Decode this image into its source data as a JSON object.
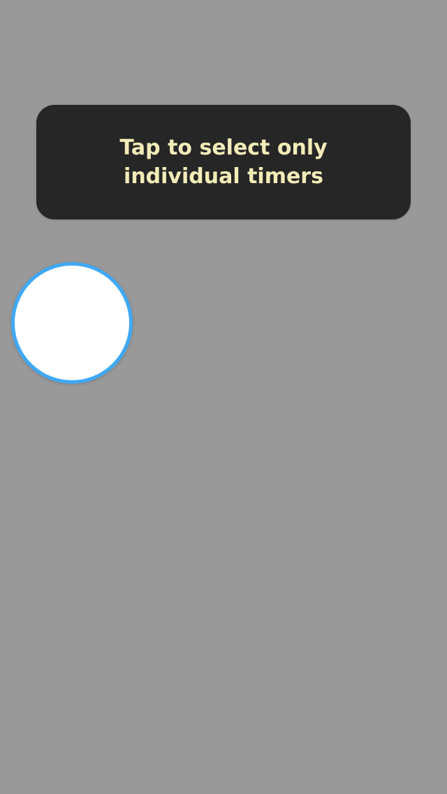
{
  "tutorial": {
    "hint_text": "Tap to select only individual timers"
  },
  "colors": {
    "overlay_background": "#999999",
    "tooltip_background": "#262626",
    "tooltip_text": "#f3ecb8",
    "target_ring": "#3fa9f5",
    "target_fill": "#ffffff"
  }
}
